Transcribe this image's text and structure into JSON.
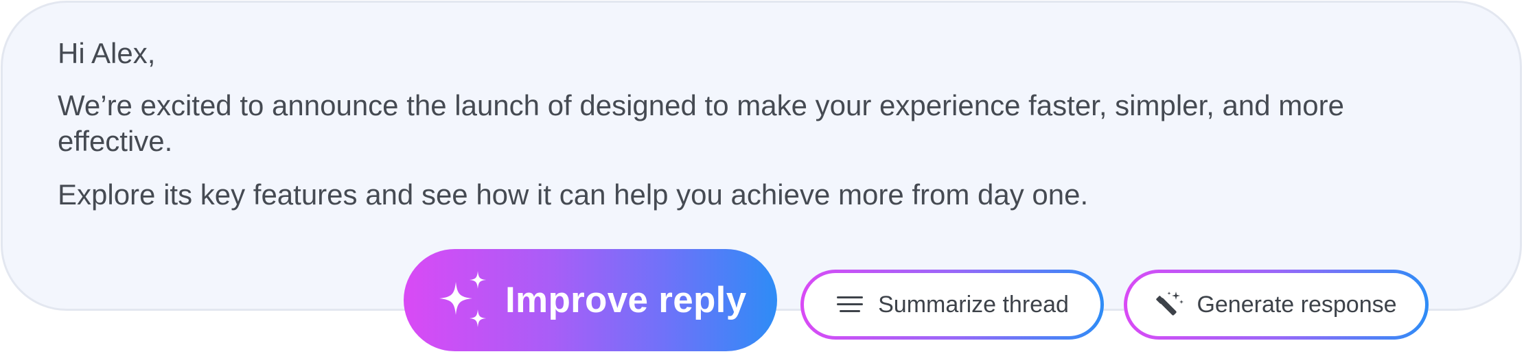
{
  "message": {
    "greeting": "Hi Alex,",
    "paragraph_1": "We’re excited to announce the launch of designed to make your experience faster, simpler, and more effective.",
    "paragraph_2": "Explore its key features and see how it can help you achieve more from day one."
  },
  "actions": {
    "improve_reply": {
      "label": "Improve reply",
      "icon": "sparkles-icon"
    },
    "summarize_thread": {
      "label": "Summarize thread",
      "icon": "lines-icon"
    },
    "generate_response": {
      "label": "Generate response",
      "icon": "magic-wand-icon"
    }
  },
  "colors": {
    "card_background": "#f3f6fd",
    "text": "#454a52",
    "gradient_start": "#d94af5",
    "gradient_end": "#2e8cf6"
  }
}
